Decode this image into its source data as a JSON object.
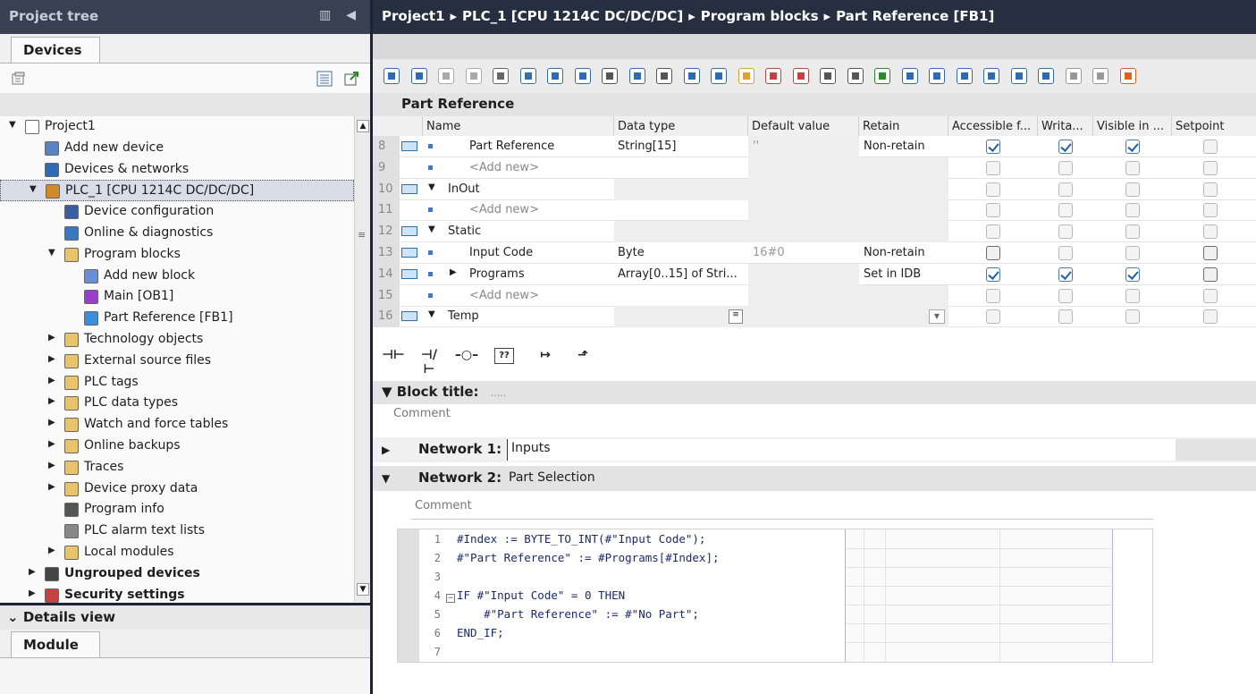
{
  "project_tree": {
    "title": "Project tree",
    "tab": "Devices",
    "items": [
      {
        "label": "Project1",
        "depth": 0,
        "expand": "down",
        "icon": "project-icon"
      },
      {
        "label": "Add new device",
        "depth": 1,
        "expand": "",
        "icon": "add-device-icon"
      },
      {
        "label": "Devices & networks",
        "depth": 1,
        "expand": "",
        "icon": "network-icon"
      },
      {
        "label": "PLC_1 [CPU 1214C DC/DC/DC]",
        "depth": 1,
        "expand": "down",
        "icon": "plc-icon"
      },
      {
        "label": "Device configuration",
        "depth": 2,
        "expand": "",
        "icon": "device-config-icon"
      },
      {
        "label": "Online & diagnostics",
        "depth": 2,
        "expand": "",
        "icon": "diagnostics-icon"
      },
      {
        "label": "Program blocks",
        "depth": 2,
        "expand": "down",
        "icon": "folder-icon"
      },
      {
        "label": "Add new block",
        "depth": 3,
        "expand": "",
        "icon": "add-block-icon"
      },
      {
        "label": "Main [OB1]",
        "depth": 3,
        "expand": "",
        "icon": "ob-block-icon"
      },
      {
        "label": "Part Reference [FB1]",
        "depth": 3,
        "expand": "",
        "icon": "fb-block-icon"
      },
      {
        "label": "Technology objects",
        "depth": 2,
        "expand": "right",
        "icon": "folder-icon"
      },
      {
        "label": "External source files",
        "depth": 2,
        "expand": "right",
        "icon": "folder-icon"
      },
      {
        "label": "PLC tags",
        "depth": 2,
        "expand": "right",
        "icon": "folder-icon"
      },
      {
        "label": "PLC data types",
        "depth": 2,
        "expand": "right",
        "icon": "folder-icon"
      },
      {
        "label": "Watch and force tables",
        "depth": 2,
        "expand": "right",
        "icon": "folder-icon"
      },
      {
        "label": "Online backups",
        "depth": 2,
        "expand": "right",
        "icon": "folder-icon"
      },
      {
        "label": "Traces",
        "depth": 2,
        "expand": "right",
        "icon": "folder-icon"
      },
      {
        "label": "Device proxy data",
        "depth": 2,
        "expand": "right",
        "icon": "folder-icon"
      },
      {
        "label": "Program info",
        "depth": 2,
        "expand": "",
        "icon": "program-info-icon"
      },
      {
        "label": "PLC alarm text lists",
        "depth": 2,
        "expand": "",
        "icon": "text-list-icon"
      },
      {
        "label": "Local modules",
        "depth": 2,
        "expand": "right",
        "icon": "folder-icon"
      },
      {
        "label": "Ungrouped devices",
        "depth": 1,
        "expand": "right",
        "icon": "ungrouped-icon"
      },
      {
        "label": "Security settings",
        "depth": 1,
        "expand": "right",
        "icon": "security-icon"
      }
    ]
  },
  "details_view": {
    "title": "Details view",
    "tab": "Module"
  },
  "breadcrumb": [
    "Project1",
    "PLC_1 [CPU 1214C DC/DC/DC]",
    "Program blocks",
    "Part Reference [FB1]"
  ],
  "interface": {
    "title": "Part Reference",
    "columns": [
      "Name",
      "Data type",
      "Default value",
      "Retain",
      "Accessible f...",
      "Writa...",
      "Visible in ...",
      "Setpoint"
    ],
    "rows": [
      {
        "num": "8",
        "name": "Part Reference",
        "indent": 2,
        "expand": "",
        "type": "String[15]",
        "default": "''",
        "retain": "Non-retain",
        "checks": [
          "on",
          "on",
          "on",
          "off"
        ],
        "icon": true
      },
      {
        "num": "9",
        "name": "<Add new>",
        "indent": 2,
        "expand": "",
        "type": "",
        "default": "",
        "retain": "",
        "checks": [
          "off",
          "off",
          "off",
          "off"
        ],
        "icon": false,
        "placeholder": true
      },
      {
        "num": "10",
        "name": "InOut",
        "indent": 1,
        "expand": "down",
        "type": "",
        "default": "",
        "retain": "",
        "checks": [
          "off",
          "off",
          "off",
          "off"
        ],
        "icon": true,
        "section": true
      },
      {
        "num": "11",
        "name": "<Add new>",
        "indent": 2,
        "expand": "",
        "type": "",
        "default": "",
        "retain": "",
        "checks": [
          "off",
          "off",
          "off",
          "off"
        ],
        "icon": false,
        "placeholder": true
      },
      {
        "num": "12",
        "name": "Static",
        "indent": 1,
        "expand": "down",
        "type": "",
        "default": "",
        "retain": "",
        "checks": [
          "off",
          "off",
          "off",
          "off"
        ],
        "icon": true,
        "section": true
      },
      {
        "num": "13",
        "name": "Input Code",
        "indent": 2,
        "expand": "",
        "type": "Byte",
        "default": "16#0",
        "retain": "Non-retain",
        "checks": [
          "dark",
          "off",
          "off",
          "dark"
        ],
        "icon": true
      },
      {
        "num": "14",
        "name": "Programs",
        "indent": 2,
        "expand": "right",
        "type": "Array[0..15] of Stri...",
        "default": "",
        "retain": "Set in IDB",
        "checks": [
          "on",
          "on",
          "on",
          "dark"
        ],
        "icon": true
      },
      {
        "num": "15",
        "name": "<Add new>",
        "indent": 2,
        "expand": "",
        "type": "",
        "default": "",
        "retain": "",
        "checks": [
          "off",
          "off",
          "off",
          "off"
        ],
        "icon": false,
        "placeholder": true
      },
      {
        "num": "16",
        "name": "Temp",
        "indent": 1,
        "expand": "down",
        "type": "",
        "default": "",
        "retain": "",
        "checks": [
          "off",
          "off",
          "off",
          "off"
        ],
        "icon": true,
        "section": true
      }
    ]
  },
  "block": {
    "title": "Block title:",
    "title_dots": ".....",
    "comment": "Comment"
  },
  "networks": [
    {
      "label": "Network 1:",
      "title": "Inputs"
    },
    {
      "label": "Network 2:",
      "title": "Part Selection",
      "comment": "Comment"
    }
  ],
  "code": [
    {
      "n": "1",
      "text": "#Index := BYTE_TO_INT(#\"Input Code\");"
    },
    {
      "n": "2",
      "text": "#\"Part Reference\" := #Programs[#Index];"
    },
    {
      "n": "3",
      "text": ""
    },
    {
      "n": "4",
      "text": "IF #\"Input Code\" = 0 THEN",
      "fold": true
    },
    {
      "n": "5",
      "text": "    #\"Part Reference\" := #\"No Part\";"
    },
    {
      "n": "6",
      "text": "END_IF;"
    },
    {
      "n": "7",
      "text": ""
    }
  ],
  "colors": {
    "title_bar": "#384152",
    "breadcrumb_bar": "#262f40",
    "accent": "#2160a8"
  }
}
